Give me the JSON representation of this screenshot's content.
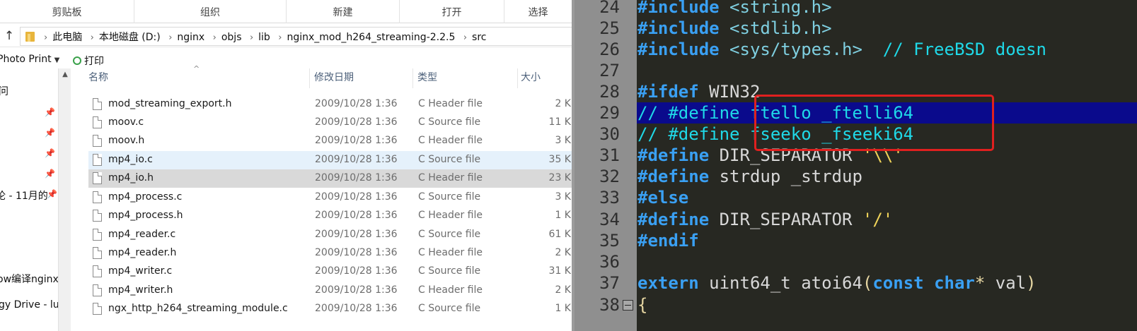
{
  "ribbon": {
    "groups": [
      "剪贴板",
      "组织",
      "新建",
      "打开",
      "选择"
    ]
  },
  "address": {
    "up_glyph": "↑",
    "path": [
      "此电脑",
      "本地磁盘 (D:)",
      "nginx",
      "objs",
      "lib",
      "nginx_mod_h264_streaming-2.2.5",
      "src"
    ]
  },
  "toolbar": {
    "photo_print": "Photo Print",
    "print": "打印"
  },
  "nav": {
    "items": [
      "问",
      "论 - 11月的",
      "ow编译nginx",
      "gy Drive - lu"
    ]
  },
  "columns": {
    "name": "名称",
    "date": "修改日期",
    "type": "类型",
    "size": "大小"
  },
  "files": [
    {
      "name": "mod_streaming_export.h",
      "date": "2009/10/28 1:36",
      "type": "C Header file",
      "size": "2 K"
    },
    {
      "name": "moov.c",
      "date": "2009/10/28 1:36",
      "type": "C Source file",
      "size": "11 K"
    },
    {
      "name": "moov.h",
      "date": "2009/10/28 1:36",
      "type": "C Header file",
      "size": "3 K"
    },
    {
      "name": "mp4_io.c",
      "date": "2009/10/28 1:36",
      "type": "C Source file",
      "size": "35 K"
    },
    {
      "name": "mp4_io.h",
      "date": "2009/10/28 1:36",
      "type": "C Header file",
      "size": "23 K"
    },
    {
      "name": "mp4_process.c",
      "date": "2009/10/28 1:36",
      "type": "C Source file",
      "size": "3 K"
    },
    {
      "name": "mp4_process.h",
      "date": "2009/10/28 1:36",
      "type": "C Header file",
      "size": "1 K"
    },
    {
      "name": "mp4_reader.c",
      "date": "2009/10/28 1:36",
      "type": "C Source file",
      "size": "61 K"
    },
    {
      "name": "mp4_reader.h",
      "date": "2009/10/28 1:36",
      "type": "C Header file",
      "size": "2 K"
    },
    {
      "name": "mp4_writer.c",
      "date": "2009/10/28 1:36",
      "type": "C Source file",
      "size": "31 K"
    },
    {
      "name": "mp4_writer.h",
      "date": "2009/10/28 1:36",
      "type": "C Header file",
      "size": "2 K"
    },
    {
      "name": "ngx_http_h264_streaming_module.c",
      "date": "2009/10/28 1:36",
      "type": "C Source file",
      "size": "1 K"
    }
  ],
  "editor": {
    "line_numbers": [
      "24",
      "25",
      "26",
      "27",
      "28",
      "29",
      "30",
      "31",
      "32",
      "33",
      "34",
      "35",
      "36",
      "37",
      "38"
    ],
    "l24": {
      "kw": "#include",
      "rest": "<string.h>"
    },
    "l25": {
      "kw": "#include",
      "rest": "<stdlib.h>"
    },
    "l26": {
      "kw": "#include",
      "rest": "<sys/types.h>",
      "comment": "// FreeBSD doesn"
    },
    "l28": {
      "kw": "#ifdef",
      "rest": "WIN32"
    },
    "l29": {
      "comment": "// #define ftello _ftelli64"
    },
    "l30": {
      "comment": "// #define fseeko _fseeki64"
    },
    "l31": {
      "kw": "#define",
      "rest": "DIR_SEPARATOR",
      "str": "'\\\\'"
    },
    "l32": {
      "kw": "#define",
      "rest": "strdup _strdup"
    },
    "l33": {
      "kw": "#else"
    },
    "l34": {
      "kw": "#define",
      "rest": "DIR_SEPARATOR",
      "str": "'/'"
    },
    "l35": {
      "kw": "#endif"
    },
    "l37": {
      "kw": "extern",
      "type": "uint64_t",
      "fn": "atoi64",
      "kw2": "const",
      "kw3": "char",
      "star": "*",
      "arg": "val",
      "close": ")"
    },
    "l38": {
      "brace": "{"
    }
  }
}
